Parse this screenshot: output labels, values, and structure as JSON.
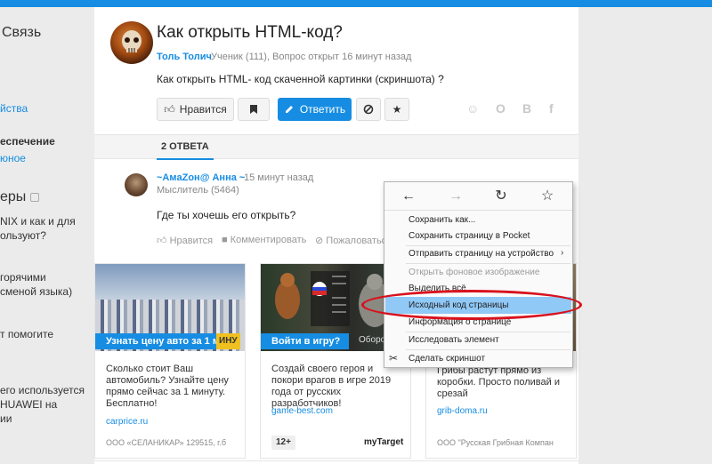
{
  "colors": {
    "accent": "#168de2",
    "highlight": "#90c8f6",
    "oval": "#d8121d"
  },
  "sidebar": {
    "heading1": "Связь",
    "link1": "йства",
    "heading2": "еспечение",
    "link2": "юное",
    "heading3": "еры",
    "q1_line1": "NIX и как и для",
    "q1_line2": "ользуют?",
    "q2_line1": "горячими",
    "q2_line2": "сменой языка)",
    "q3_line1": "т помогите",
    "q4_line1": "его используется",
    "q4_line2": "HUAWEI на",
    "q4_line3": "ии"
  },
  "question": {
    "title": "Как открыть HTML-код?",
    "author": "Толь Толич",
    "meta": "Ученик (111), Вопрос открыт 16 минут назад",
    "text": "Как открыть HTML- код скаченной картинки (скриншота) ?",
    "like_label": "Нравится",
    "answer_label": "Ответить"
  },
  "share_icons": [
    "smile-icon",
    "odnoklassniki-icon",
    "vk-icon",
    "facebook-icon"
  ],
  "answers_tab": "2 ОТВЕТА",
  "answer": {
    "author": "~AмaZoн@ Анна ~",
    "time": "15 минут назад",
    "rank": "Мыслитель (5464)",
    "text": "Где ты хочешь его открыть?",
    "like_label": "Нравится",
    "comment_label": "Комментировать",
    "complain_label": "Пожаловатьс"
  },
  "cards": [
    {
      "badge": "Узнать цену авто за 1 мин",
      "badge_tail": "ИНУ",
      "text": "Сколько стоит Ваш автомобиль? Узнайте цену прямо сейчас за 1 минуту. Бесплатно!",
      "domain": "carprice.ru",
      "footer": "ООО «СЕЛАНИКАР» 129515, г.б"
    },
    {
      "badge": "Войти в игру?",
      "badge_tail": "Оборотень",
      "text": "Создай своего героя и покори врагов в игре 2019 года от русских разработчиков!",
      "domain": "game-best.com",
      "age": "12+",
      "brand": "myTarget"
    },
    {
      "badge": "",
      "text": "коробки. Просто поливай и срезай",
      "text_top": "Грибы растут прямо из",
      "domain": "grib-doma.ru",
      "footer": "ООО \"Русская Грибная Компан"
    }
  ],
  "context_menu": {
    "items": [
      {
        "label": "Сохранить как..."
      },
      {
        "label": "Сохранить страницу в Pocket"
      },
      {
        "label": "Отправить страницу на устройство"
      },
      {
        "label": "Открыть фоновое изображение"
      },
      {
        "label": "Выделить всё"
      },
      {
        "label": "Исходный код страницы"
      },
      {
        "label": "Информация о странице"
      },
      {
        "label": "Исследовать элемент"
      },
      {
        "label": "Сделать скриншот"
      }
    ]
  }
}
